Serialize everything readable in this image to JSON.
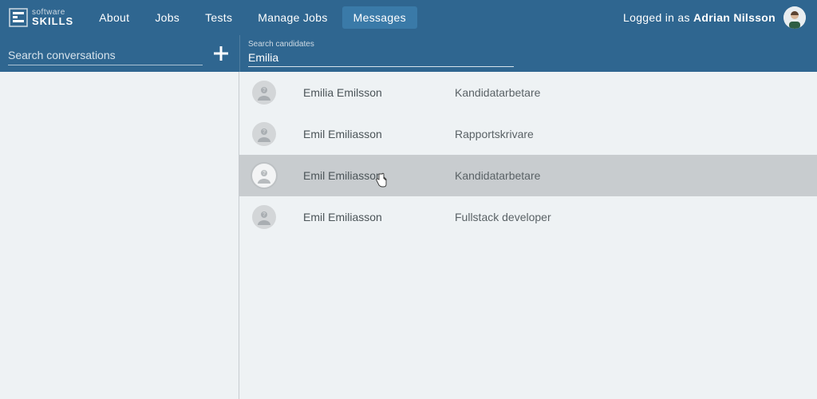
{
  "brand": {
    "line1": "software",
    "line2": "SKILLS"
  },
  "nav": {
    "items": [
      {
        "label": "About",
        "active": false
      },
      {
        "label": "Jobs",
        "active": false
      },
      {
        "label": "Tests",
        "active": false
      },
      {
        "label": "Manage Jobs",
        "active": false
      },
      {
        "label": "Messages",
        "active": true
      }
    ]
  },
  "user": {
    "prefix": "Logged in as ",
    "name": "Adrian Nilsson"
  },
  "sidebar": {
    "search_placeholder": "Search conversations"
  },
  "candidate_search": {
    "label": "Search candidates",
    "value": "Emilia"
  },
  "candidates": [
    {
      "name": "Emilia Emilsson",
      "role": "Kandidatarbetare",
      "hovered": false
    },
    {
      "name": "Emil Emiliasson",
      "role": "Rapportskrivare",
      "hovered": false
    },
    {
      "name": "Emil Emiliasson",
      "role": "Kandidatarbetare",
      "hovered": true
    },
    {
      "name": "Emil Emiliasson",
      "role": "Fullstack developer",
      "hovered": false
    }
  ],
  "colors": {
    "brand_blue": "#2f6690",
    "brand_blue_active": "#3a7aa8",
    "page_bg": "#eef2f4",
    "row_hover": "#c8cccf"
  }
}
